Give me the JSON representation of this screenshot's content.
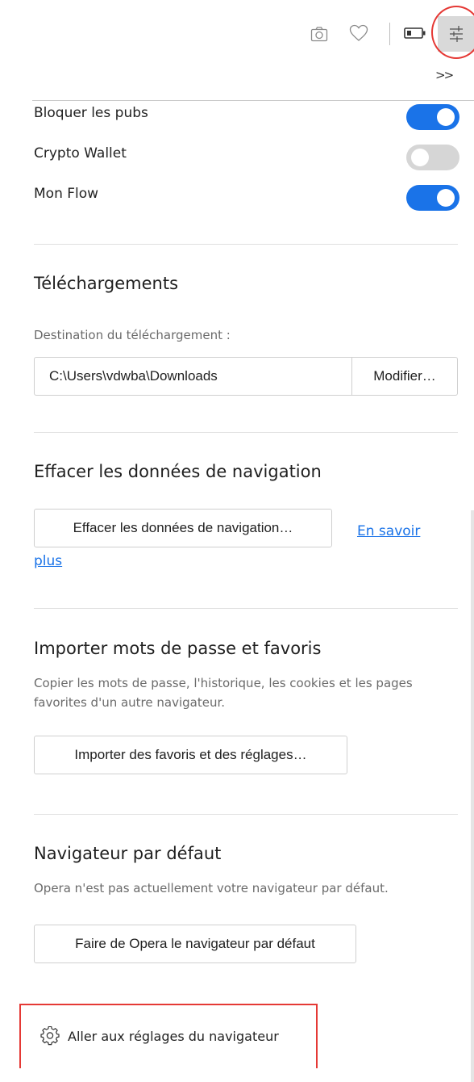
{
  "toolbar": {
    "icons": [
      "camera-icon",
      "heart-icon",
      "battery-icon",
      "easy-setup-icon"
    ],
    "more_label": ">>"
  },
  "features": [
    {
      "label": "Bloquer les pubs",
      "enabled": true
    },
    {
      "label": "Crypto Wallet",
      "enabled": false
    },
    {
      "label": "Mon Flow",
      "enabled": true
    }
  ],
  "downloads": {
    "title": "Téléchargements",
    "destination_label": "Destination du téléchargement :",
    "path_value": "C:\\Users\\vdwba\\Downloads",
    "change_button": "Modifier…"
  },
  "clear_data": {
    "title": "Effacer les données de navigation",
    "button": "Effacer les données de navigation…",
    "learn_more_part1": "En savoir",
    "learn_more_part2": "plus"
  },
  "import": {
    "title": "Importer mots de passe et favoris",
    "description": "Copier les mots de passe, l'historique, les cookies et les pages favorites d'un autre navigateur.",
    "button": "Importer des favoris et des réglages…"
  },
  "default_browser": {
    "title": "Navigateur par défaut",
    "description": "Opera n'est pas actuellement votre navigateur par défaut.",
    "button": "Faire de Opera le navigateur par défaut"
  },
  "footer": {
    "settings_link": "Aller aux réglages du navigateur"
  },
  "colors": {
    "accent": "#1a73e8",
    "highlight": "#e53935",
    "toggle_off": "#d6d6d6"
  }
}
